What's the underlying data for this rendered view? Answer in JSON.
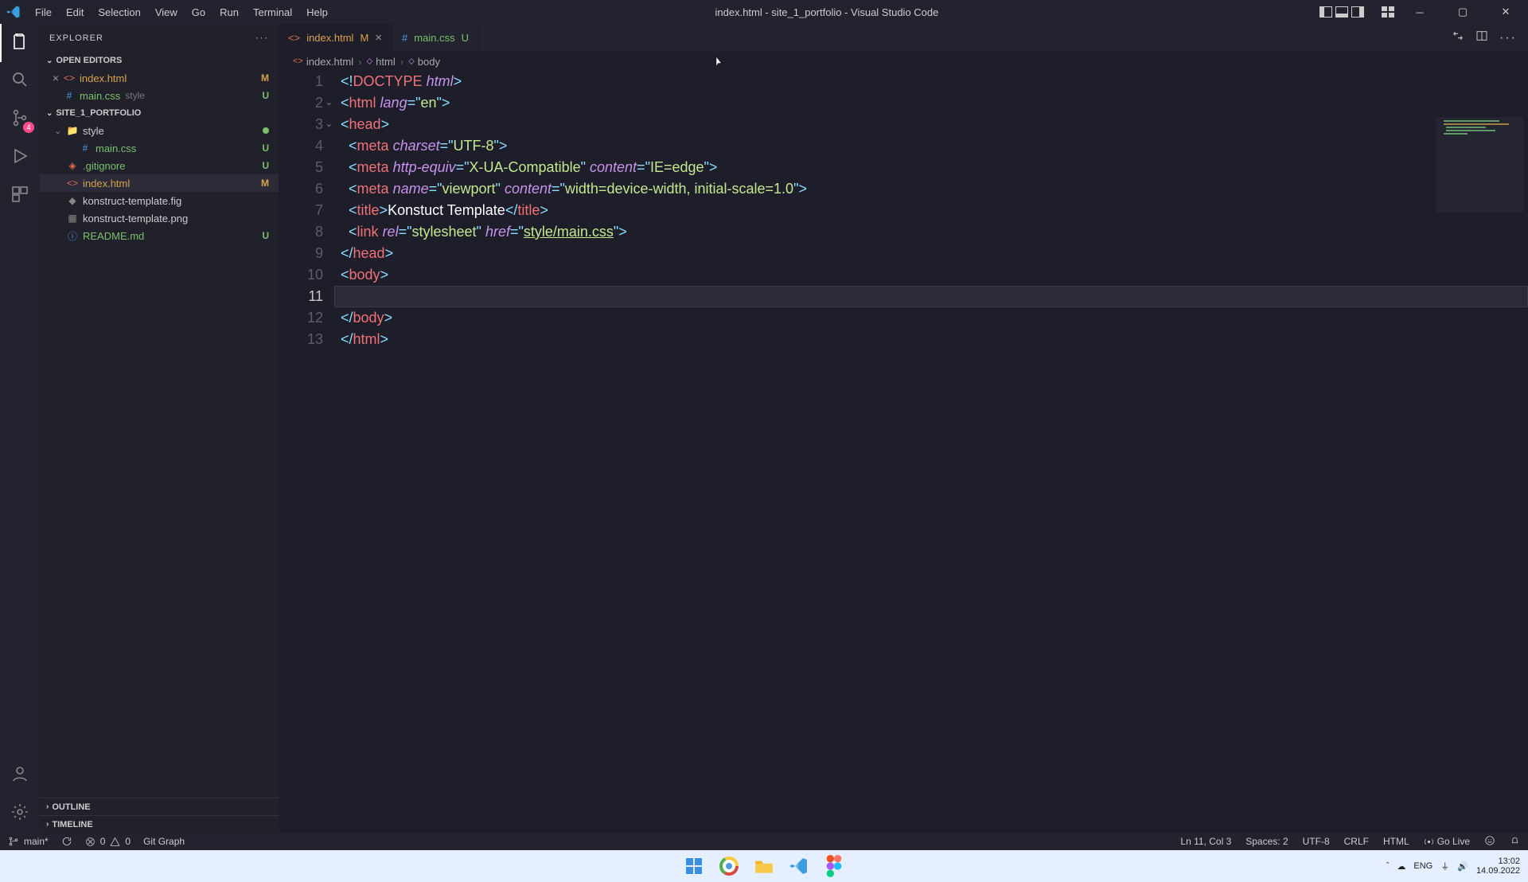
{
  "window": {
    "title": "index.html - site_1_portfolio - Visual Studio Code"
  },
  "menu": [
    "File",
    "Edit",
    "Selection",
    "View",
    "Go",
    "Run",
    "Terminal",
    "Help"
  ],
  "explorer": {
    "title": "EXPLORER",
    "sections": {
      "open_editors": {
        "label": "OPEN EDITORS",
        "items": [
          {
            "name": "index.html",
            "secondary": "",
            "badge": "M",
            "icon": "html",
            "close": true
          },
          {
            "name": "main.css",
            "secondary": "style",
            "badge": "U",
            "icon": "css",
            "close": false
          }
        ]
      },
      "project": {
        "label": "SITE_1_PORTFOLIO",
        "items": [
          {
            "name": "style",
            "icon": "folder",
            "indent": 1,
            "dot": true,
            "chev": "down"
          },
          {
            "name": "main.css",
            "icon": "css",
            "indent": 2,
            "badge": "U"
          },
          {
            "name": ".gitignore",
            "icon": "git",
            "indent": 1,
            "badge": "U"
          },
          {
            "name": "index.html",
            "icon": "html",
            "indent": 1,
            "badge": "M",
            "selected": true
          },
          {
            "name": "konstruct-template.fig",
            "icon": "fig",
            "indent": 1
          },
          {
            "name": "konstruct-template.png",
            "icon": "img",
            "indent": 1
          },
          {
            "name": "README.md",
            "icon": "md",
            "indent": 1,
            "badge": "U"
          }
        ]
      },
      "outline": {
        "label": "OUTLINE"
      },
      "timeline": {
        "label": "TIMELINE"
      }
    }
  },
  "tabs": [
    {
      "name": "index.html",
      "badge": "M",
      "icon": "html",
      "active": true
    },
    {
      "name": "main.css",
      "badge": "U",
      "icon": "css",
      "active": false
    }
  ],
  "breadcrumb": [
    {
      "text": "index.html",
      "icon": "html"
    },
    {
      "text": "html",
      "icon": "tag"
    },
    {
      "text": "body",
      "icon": "tag"
    }
  ],
  "editor": {
    "lines": [
      {
        "n": 1,
        "segments": [
          [
            "tag-br",
            "<"
          ],
          [
            "doctype",
            "!"
          ],
          [
            "tag-name",
            "DOCTYPE"
          ],
          [
            "",
            " "
          ],
          [
            "attr-name",
            "html"
          ],
          [
            "tag-br",
            ">"
          ]
        ]
      },
      {
        "n": 2,
        "fold": true,
        "segments": [
          [
            "tag-br",
            "<"
          ],
          [
            "tag-name",
            "html"
          ],
          [
            "",
            " "
          ],
          [
            "attr-name",
            "lang"
          ],
          [
            "tag-br",
            "="
          ],
          [
            "str-quote",
            "\""
          ],
          [
            "attr-val",
            "en"
          ],
          [
            "str-quote",
            "\""
          ],
          [
            "tag-br",
            ">"
          ]
        ]
      },
      {
        "n": 3,
        "fold": true,
        "segments": [
          [
            "tag-br",
            "<"
          ],
          [
            "tag-name",
            "head"
          ],
          [
            "tag-br",
            ">"
          ]
        ]
      },
      {
        "n": 4,
        "indent": 1,
        "segments": [
          [
            "tag-br",
            "<"
          ],
          [
            "tag-name",
            "meta"
          ],
          [
            "",
            " "
          ],
          [
            "attr-name",
            "charset"
          ],
          [
            "tag-br",
            "="
          ],
          [
            "str-quote",
            "\""
          ],
          [
            "attr-val",
            "UTF-8"
          ],
          [
            "str-quote",
            "\""
          ],
          [
            "tag-br",
            ">"
          ]
        ]
      },
      {
        "n": 5,
        "indent": 1,
        "segments": [
          [
            "tag-br",
            "<"
          ],
          [
            "tag-name",
            "meta"
          ],
          [
            "",
            " "
          ],
          [
            "attr-name",
            "http-equiv"
          ],
          [
            "tag-br",
            "="
          ],
          [
            "str-quote",
            "\""
          ],
          [
            "attr-val",
            "X-UA-Compatible"
          ],
          [
            "str-quote",
            "\""
          ],
          [
            "",
            " "
          ],
          [
            "attr-name",
            "content"
          ],
          [
            "tag-br",
            "="
          ],
          [
            "str-quote",
            "\""
          ],
          [
            "attr-val",
            "IE=edge"
          ],
          [
            "str-quote",
            "\""
          ],
          [
            "tag-br",
            ">"
          ]
        ]
      },
      {
        "n": 6,
        "indent": 1,
        "segments": [
          [
            "tag-br",
            "<"
          ],
          [
            "tag-name",
            "meta"
          ],
          [
            "",
            " "
          ],
          [
            "attr-name",
            "name"
          ],
          [
            "tag-br",
            "="
          ],
          [
            "str-quote",
            "\""
          ],
          [
            "attr-val",
            "viewport"
          ],
          [
            "str-quote",
            "\""
          ],
          [
            "",
            " "
          ],
          [
            "attr-name",
            "content"
          ],
          [
            "tag-br",
            "="
          ],
          [
            "str-quote",
            "\""
          ],
          [
            "attr-val",
            "width=device-width, initial-scale=1.0"
          ],
          [
            "str-quote",
            "\""
          ],
          [
            "tag-br",
            ">"
          ]
        ]
      },
      {
        "n": 7,
        "indent": 1,
        "segments": [
          [
            "tag-br",
            "<"
          ],
          [
            "tag-name",
            "title"
          ],
          [
            "tag-br",
            ">"
          ],
          [
            "text-white",
            "Konstuct Template"
          ],
          [
            "tag-br",
            "</"
          ],
          [
            "tag-name",
            "title"
          ],
          [
            "tag-br",
            ">"
          ]
        ]
      },
      {
        "n": 8,
        "indent": 1,
        "segments": [
          [
            "tag-br",
            "<"
          ],
          [
            "tag-name",
            "link"
          ],
          [
            "",
            " "
          ],
          [
            "attr-name",
            "rel"
          ],
          [
            "tag-br",
            "="
          ],
          [
            "str-quote",
            "\""
          ],
          [
            "attr-val",
            "stylesheet"
          ],
          [
            "str-quote",
            "\""
          ],
          [
            "",
            " "
          ],
          [
            "attr-name",
            "href"
          ],
          [
            "tag-br",
            "="
          ],
          [
            "str-quote",
            "\""
          ],
          [
            "attr-val underline",
            "style/main.css"
          ],
          [
            "str-quote",
            "\""
          ],
          [
            "tag-br",
            ">"
          ]
        ]
      },
      {
        "n": 9,
        "segments": [
          [
            "tag-br",
            "</"
          ],
          [
            "tag-name",
            "head"
          ],
          [
            "tag-br",
            ">"
          ]
        ]
      },
      {
        "n": 10,
        "segments": [
          [
            "tag-br",
            "<"
          ],
          [
            "tag-name",
            "body"
          ],
          [
            "tag-br",
            ">"
          ]
        ]
      },
      {
        "n": 11,
        "cursor": true,
        "indent": 1,
        "segments": []
      },
      {
        "n": 12,
        "segments": [
          [
            "tag-br",
            "</"
          ],
          [
            "tag-name",
            "body"
          ],
          [
            "tag-br",
            ">"
          ]
        ]
      },
      {
        "n": 13,
        "segments": [
          [
            "tag-br",
            "</"
          ],
          [
            "tag-name",
            "html"
          ],
          [
            "tag-br",
            ">"
          ]
        ]
      }
    ]
  },
  "statusbar": {
    "branch": "main*",
    "errors": "0",
    "warnings": "0",
    "git_graph": "Git Graph",
    "position": "Ln 11, Col 3",
    "spaces": "Spaces: 2",
    "encoding": "UTF-8",
    "eol": "CRLF",
    "lang": "HTML",
    "golive": "Go Live"
  },
  "tray": {
    "lang": "ENG",
    "time": "13:02",
    "date": "14.09.2022"
  }
}
